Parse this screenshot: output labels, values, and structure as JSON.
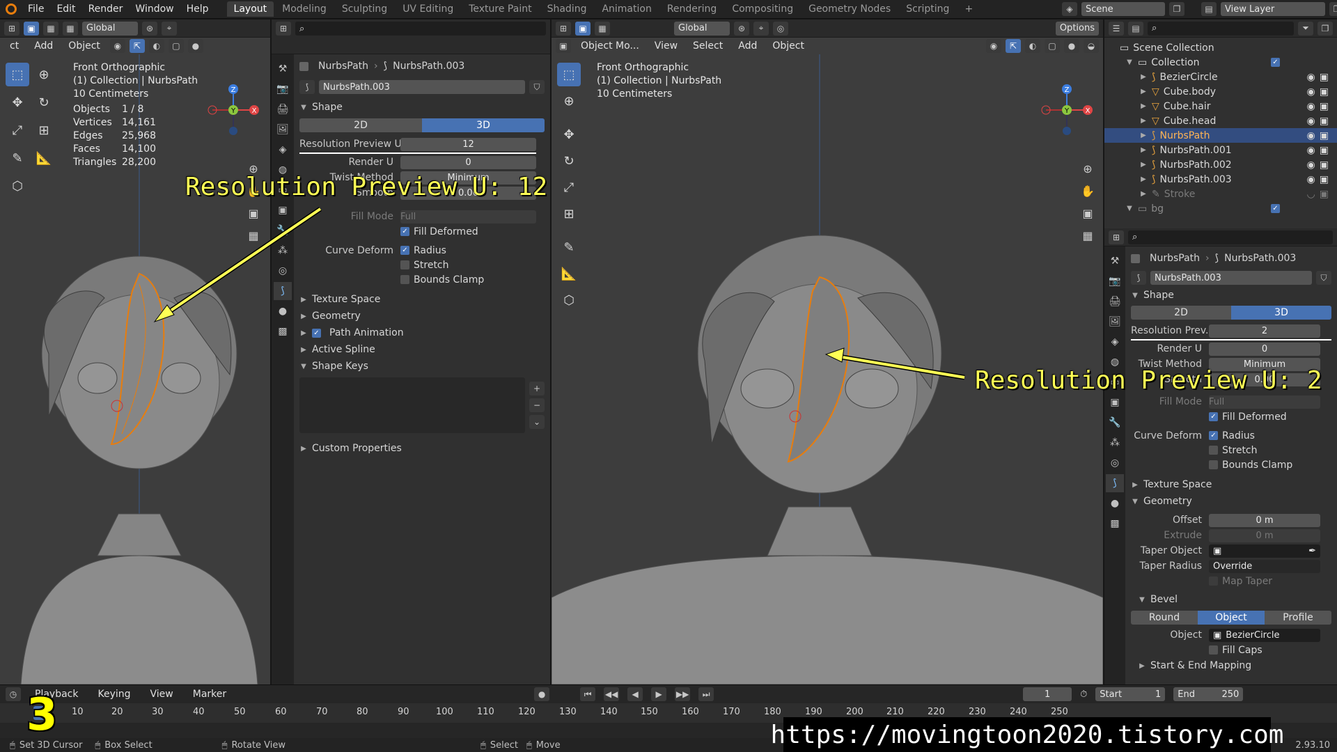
{
  "topbar": {
    "menus": [
      "File",
      "Edit",
      "Render",
      "Window",
      "Help"
    ],
    "workspaces": [
      "Layout",
      "Modeling",
      "Sculpting",
      "UV Editing",
      "Texture Paint",
      "Shading",
      "Animation",
      "Rendering",
      "Compositing",
      "Geometry Nodes",
      "Scripting"
    ],
    "active_workspace": "Layout",
    "add_workspace": "+",
    "scene_label": "Scene",
    "view_layer_label": "View Layer"
  },
  "left_viewport": {
    "header": {
      "menus": [
        "ct",
        "Add",
        "Object"
      ],
      "transform": "Global"
    },
    "info": [
      "Front Orthographic",
      "(1) Collection | NurbsPath",
      "10 Centimeters"
    ],
    "stats": [
      {
        "label": "Objects",
        "value": "1 / 8"
      },
      {
        "label": "Vertices",
        "value": "14,161"
      },
      {
        "label": "Edges",
        "value": "25,968"
      },
      {
        "label": "Faces",
        "value": "14,100"
      },
      {
        "label": "Triangles",
        "value": "28,200"
      }
    ],
    "annotation": "Resolution Preview U: 12"
  },
  "middle_props": {
    "breadcrumb_object": "NurbsPath",
    "breadcrumb_data": "NurbsPath.003",
    "data_name": "NurbsPath.003",
    "shape_title": "Shape",
    "dim_2d": "2D",
    "dim_3d": "3D",
    "rows": [
      {
        "label": "Resolution Preview U",
        "value": "12"
      },
      {
        "label": "Render U",
        "value": "0"
      },
      {
        "label": "Twist Method",
        "value": "Minimum"
      },
      {
        "label": "Smooth",
        "value": "0.00"
      }
    ],
    "fill_mode_label": "Fill Mode",
    "fill_mode_value": "Full",
    "fill_deformed": "Fill Deformed",
    "curve_deform_label": "Curve Deform",
    "radius": "Radius",
    "stretch": "Stretch",
    "bounds_clamp": "Bounds Clamp",
    "sections": [
      "Texture Space",
      "Geometry",
      "Path Animation",
      "Active Spline",
      "Shape Keys"
    ],
    "custom_props": "Custom Properties"
  },
  "right_viewport": {
    "header": {
      "mode": "Object Mo...",
      "menus": [
        "View",
        "Select",
        "Add",
        "Object"
      ],
      "transform": "Global",
      "options": "Options"
    },
    "info": [
      "Front Orthographic",
      "(1) Collection | NurbsPath",
      "10 Centimeters"
    ],
    "annotation": "Resolution Preview U: 2"
  },
  "outliner": {
    "scene_collection": "Scene Collection",
    "collection": "Collection",
    "items": [
      "BezierCircle",
      "Cube.body",
      "Cube.hair",
      "Cube.head",
      "NurbsPath",
      "NurbsPath.001",
      "NurbsPath.002",
      "NurbsPath.003",
      "Stroke"
    ],
    "selected": "NurbsPath",
    "bg": "bg"
  },
  "right_props": {
    "breadcrumb_object": "NurbsPath",
    "breadcrumb_data": "NurbsPath.003",
    "data_name": "NurbsPath.003",
    "shape_title": "Shape",
    "dim_2d": "2D",
    "dim_3d": "3D",
    "rows": [
      {
        "label": "Resolution Prev...",
        "value": "2"
      },
      {
        "label": "Render U",
        "value": "0"
      },
      {
        "label": "Twist Method",
        "value": "Minimum"
      },
      {
        "label": "Smooth",
        "value": "0.00"
      }
    ],
    "fill_mode_label": "Fill Mode",
    "fill_mode_value": "Full",
    "fill_deformed": "Fill Deformed",
    "curve_deform_label": "Curve Deform",
    "radius": "Radius",
    "stretch": "Stretch",
    "bounds_clamp": "Bounds Clamp",
    "texture_space": "Texture Space",
    "geometry": "Geometry",
    "offset_label": "Offset",
    "offset_value": "0 m",
    "extrude_label": "Extrude",
    "extrude_value": "0 m",
    "taper_object_label": "Taper Object",
    "taper_radius_label": "Taper Radius",
    "taper_radius_value": "Override",
    "map_taper": "Map Taper",
    "bevel": "Bevel",
    "bevel_modes": [
      "Round",
      "Object",
      "Profile"
    ],
    "bevel_active": "Object",
    "object_label": "Object",
    "object_value": "BezierCircle",
    "fill_caps": "Fill Caps",
    "start_end": "Start & End Mapping"
  },
  "timeline": {
    "menus": [
      "Playback",
      "Keying",
      "View",
      "Marker"
    ],
    "current_frame": "1",
    "start_label": "Start",
    "start_value": "1",
    "end_label": "End",
    "end_value": "250",
    "ticks": [
      "10",
      "20",
      "30",
      "40",
      "50",
      "60",
      "70",
      "80",
      "90",
      "100",
      "110",
      "120",
      "130",
      "140",
      "150",
      "160",
      "170",
      "180",
      "190",
      "200",
      "210",
      "220",
      "230",
      "240",
      "250"
    ]
  },
  "statusbar": {
    "items": [
      "Set 3D Cursor",
      "Box Select",
      "Rotate View",
      "Select",
      "Move"
    ],
    "version": "2.93.10"
  },
  "overlay": {
    "step_number": "3",
    "url": "https://movingtoon2020.tistory.com"
  },
  "colors": {
    "accent": "#4772b3",
    "selected_orange": "#e87d0d",
    "annotation": "#ffff55"
  }
}
